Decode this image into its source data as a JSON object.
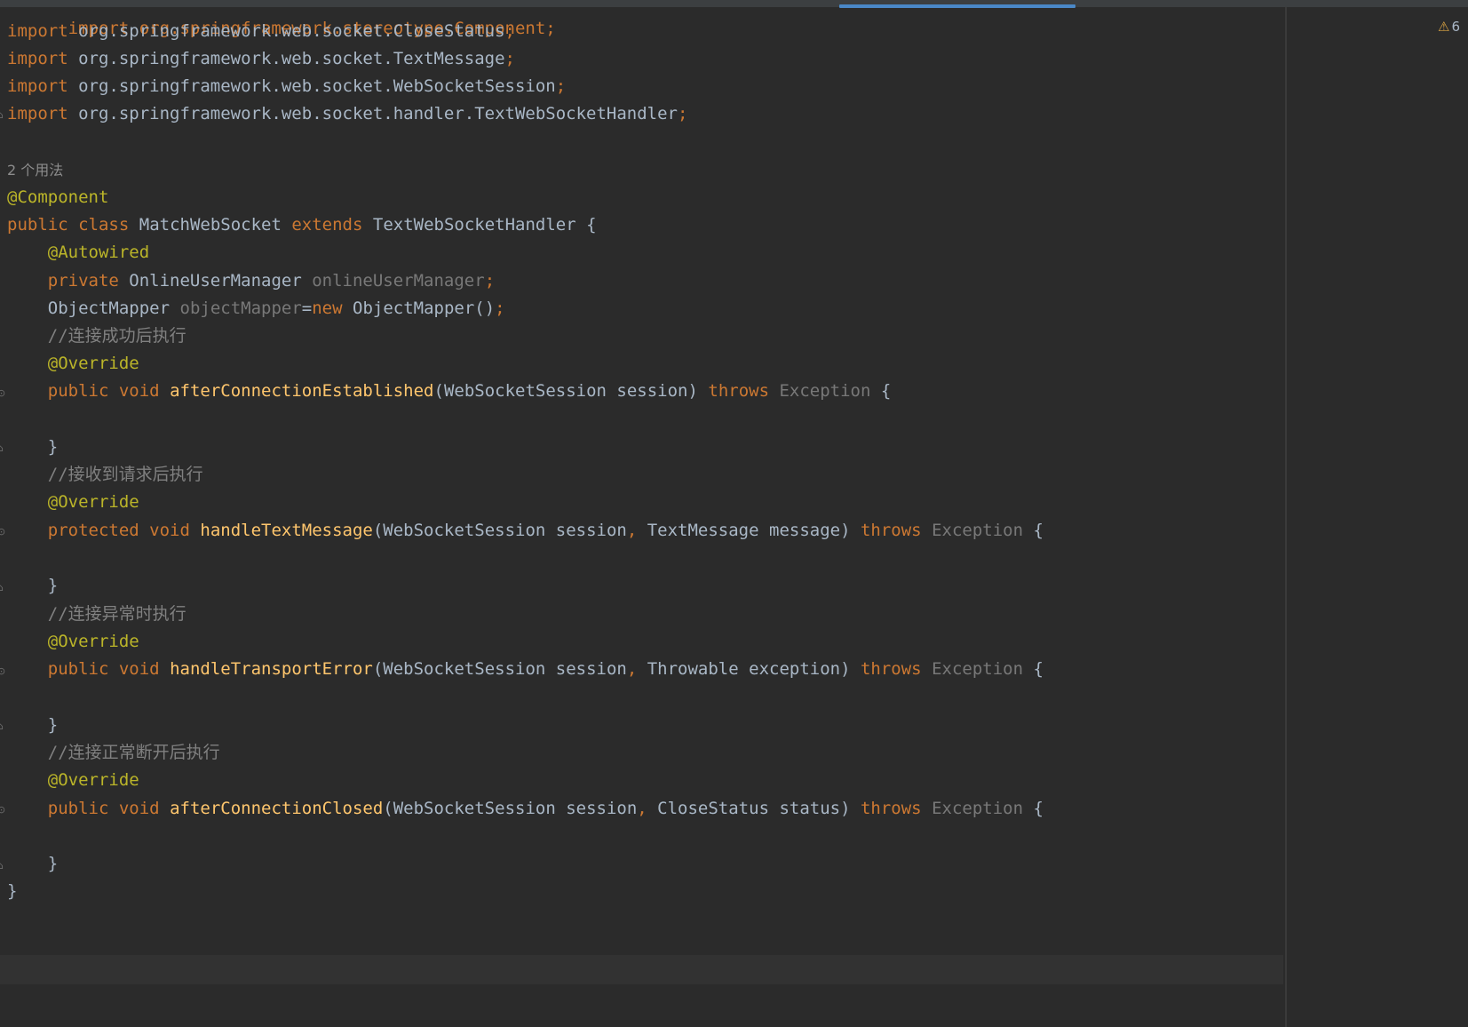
{
  "editor": {
    "usage_hint": "2 个用法",
    "warning_count": "6",
    "warning_icon": "warning-triangle-icon"
  },
  "code": {
    "line0": "import org.springframework.stereotype.Component;",
    "import1_prefix": "org.springframework.web.socket.",
    "import1_class": "CloseStatus",
    "import2_prefix": "org.springframework.web.socket.",
    "import2_class": "TextMessage",
    "import3_prefix": "org.springframework.web.socket.",
    "import3_class": "WebSocketSession",
    "import4_prefix": "org.springframework.web.socket.handler.",
    "import4_class": "TextWebSocketHandler",
    "kw_import": "import",
    "ann_component": "@Component",
    "kw_public": "public",
    "kw_class": "class",
    "class_name": "MatchWebSocket",
    "kw_extends": "extends",
    "super_class": "TextWebSocketHandler",
    "ann_autowired": "@Autowired",
    "kw_private": "private",
    "field1_type": "OnlineUserManager",
    "field1_name": "onlineUserManager",
    "field2_type": "ObjectMapper",
    "field2_name": "objectMapper",
    "kw_new": "new",
    "field2_ctor": "ObjectMapper()",
    "comment1": "//连接成功后执行",
    "ann_override": "@Override",
    "kw_void": "void",
    "kw_protected": "protected",
    "kw_throws": "throws",
    "exception": "Exception",
    "m1_name": "afterConnectionEstablished",
    "m1_params": "(WebSocketSession session)",
    "comment2": "//接收到请求后执行",
    "m2_name": "handleTextMessage",
    "m2_p1": "(WebSocketSession session",
    "m2_p2": " TextMessage message)",
    "comment3": "//连接异常时执行",
    "m3_name": "handleTransportError",
    "m3_p1": "(WebSocketSession session",
    "m3_p2": " Throwable exception)",
    "comment4": "//连接正常断开后执行",
    "m4_name": "afterConnectionClosed",
    "m4_p1": "(WebSocketSession session",
    "m4_p2": " CloseStatus status)",
    "open_brace": "{",
    "close_brace": "}",
    "semicolon": ";",
    "comma": ",",
    "equals": "="
  }
}
